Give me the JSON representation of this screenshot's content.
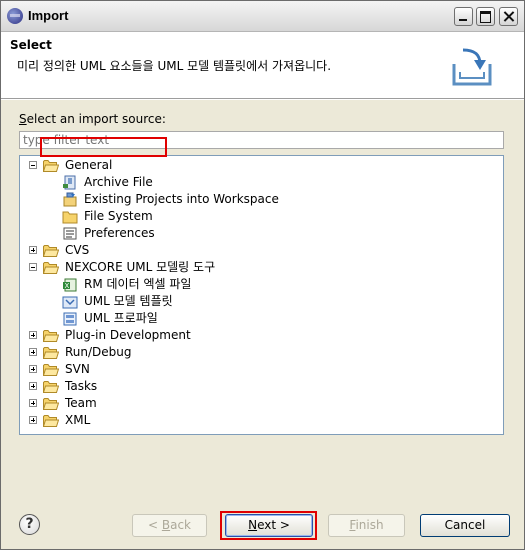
{
  "window": {
    "title": "Import"
  },
  "header": {
    "title": "Select",
    "description": "미리 정의한 UML 요소들을 UML 모델 템플릿에서 가져옵니다."
  },
  "source": {
    "label_first": "S",
    "label_rest": "elect an import source:",
    "filter_placeholder": "type filter text"
  },
  "tree": [
    {
      "label": "General",
      "expanded": true,
      "children": [
        {
          "label": "Archive File",
          "icon": "archive-file-icon"
        },
        {
          "label": "Existing Projects into Workspace",
          "icon": "project-import-icon"
        },
        {
          "label": "File System",
          "icon": "folder-icon"
        },
        {
          "label": "Preferences",
          "icon": "preferences-icon"
        }
      ]
    },
    {
      "label": "CVS",
      "expanded": false
    },
    {
      "label": "NEXCORE UML 모델링 도구",
      "expanded": true,
      "children": [
        {
          "label": "RM 데이터 엑셀 파일",
          "icon": "excel-import-icon"
        },
        {
          "label": "UML 모델 템플릿",
          "icon": "uml-template-icon",
          "selected": true
        },
        {
          "label": "UML 프로파일",
          "icon": "uml-profile-icon"
        }
      ]
    },
    {
      "label": "Plug-in Development",
      "expanded": false
    },
    {
      "label": "Run/Debug",
      "expanded": false
    },
    {
      "label": "SVN",
      "expanded": false
    },
    {
      "label": "Tasks",
      "expanded": false
    },
    {
      "label": "Team",
      "expanded": false
    },
    {
      "label": "XML",
      "expanded": false
    }
  ],
  "buttons": {
    "help": "?",
    "back_prefix": "< ",
    "back_mnemonic": "B",
    "back_rest": "ack",
    "next_mnemonic": "N",
    "next_rest": "ext >",
    "finish_mnemonic": "F",
    "finish_rest": "inish",
    "cancel": "Cancel"
  },
  "colors": {
    "highlight": "#e00000",
    "title_bar": "#e8e8e8",
    "background": "#ece9d8"
  }
}
